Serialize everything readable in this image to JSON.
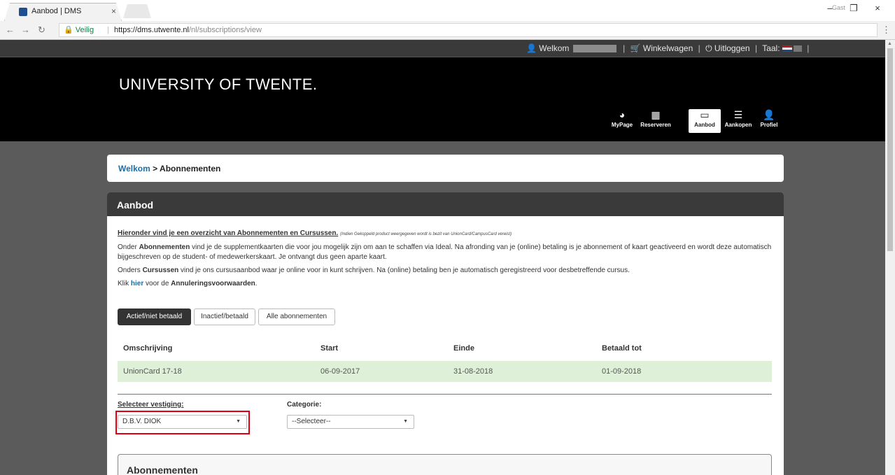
{
  "browser": {
    "tab_title": "Aanbod | DMS",
    "tab_close": "×",
    "security_label": "Veilig",
    "url_host": "https://dms.utwente.nl",
    "url_path": "/nl/subscriptions/view",
    "profile_label": "Gast",
    "window_controls": [
      "–",
      "❐",
      "×"
    ]
  },
  "topbar": {
    "welcome": "Welkom",
    "cart": "Winkelwagen",
    "logout": "Uitloggen",
    "language": "Taal:"
  },
  "header": {
    "brand": "UNIVERSITY OF TWENTE.",
    "nav": [
      {
        "label": "MyPage",
        "icon": "dashboard-icon"
      },
      {
        "label": "Reserveren",
        "icon": "calendar-icon"
      },
      {
        "label": "Aanbod",
        "icon": "card-icon"
      },
      {
        "label": "Aankopen",
        "icon": "list-icon"
      },
      {
        "label": "Profiel",
        "icon": "user-icon"
      }
    ],
    "active_nav": "Aanbod"
  },
  "breadcrumb": {
    "home": "Welkom",
    "separator": " > ",
    "current": "Abonnementen"
  },
  "panel": {
    "title": "Aanbod",
    "intro_heading": "Hieronder vind je een overzicht van Abonnementen en Cursussen.",
    "intro_note": "(Indien Gekoppeld product weergegeven wordt is bezit van UnionCard/CampusCard vereist)",
    "para1_pre": "Onder ",
    "para1_bold": "Abonnementen",
    "para1_post": " vind je de supplementkaarten die voor jou mogelijk zijn om aan te schaffen via Ideal. Na afronding van je (online) betaling is je abonnement of kaart geactiveerd en wordt deze automatisch bijgeschreven op de student- of medewerkerskaart. Je ontvangt dus geen aparte kaart.",
    "para2_pre": "Onders ",
    "para2_bold": "Cursussen",
    "para2_post": " vind je ons cursusaanbod waar je online voor in kunt schrijven. Na (online) betaling ben je automatisch geregistreerd voor desbetreffende  cursus.",
    "para3_pre": "Klik ",
    "para3_link": "hier",
    "para3_mid": " voor de ",
    "para3_bold": "Annuleringsvoorwaarden",
    "para3_end": ".",
    "filters": [
      "Actief/niet betaald",
      "Inactief/betaald",
      "Alle abonnementen"
    ],
    "table": {
      "headers": [
        "Omschrijving",
        "Start",
        "Einde",
        "Betaald tot"
      ],
      "rows": [
        [
          "UnionCard 17-18",
          "06-09-2017",
          "31-08-2018",
          "01-09-2018"
        ]
      ]
    },
    "vestiging_label": "Selecteer vestiging:",
    "vestiging_value": "D.B.V. DIOK",
    "categorie_label": "Categorie:",
    "categorie_value": "--Selecteer--",
    "subpanel_title": "Abonnementen"
  }
}
